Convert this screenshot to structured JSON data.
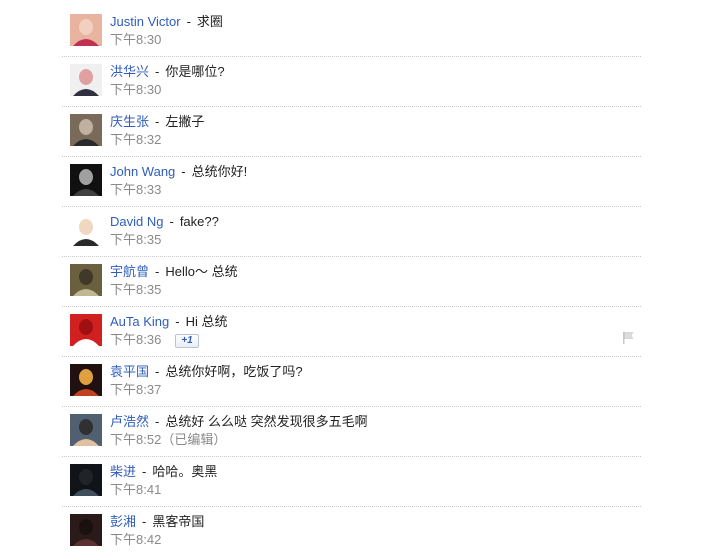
{
  "comments": [
    {
      "author": "Justin Victor",
      "separator": "-",
      "text": "求圈",
      "time": "下午8:30",
      "avatar": "avatar-pink-hair",
      "colors": [
        "#e8b4a0",
        "#c03050",
        "#f2d0c0"
      ]
    },
    {
      "author": "洪华兴",
      "separator": "-",
      "text": "你是哪位?",
      "time": "下午8:30",
      "avatar": "avatar-portrait",
      "colors": [
        "#f0f0f0",
        "#303040",
        "#e0a0a0"
      ]
    },
    {
      "author": "庆生张",
      "separator": "-",
      "text": "左撇子",
      "time": "下午8:32",
      "avatar": "avatar-man-dark",
      "colors": [
        "#7a6a5a",
        "#2a2a2a",
        "#c0b0a0"
      ]
    },
    {
      "author": "John Wang",
      "separator": "-",
      "text": "总统你好!",
      "time": "下午8:33",
      "avatar": "avatar-hooded",
      "colors": [
        "#101010",
        "#404040",
        "#a0a0a0"
      ]
    },
    {
      "author": "David Ng",
      "separator": "-",
      "text": "fake??",
      "time": "下午8:35",
      "avatar": "avatar-cartoon",
      "colors": [
        "#ffffff",
        "#2a2a2a",
        "#f0d8c0"
      ]
    },
    {
      "author": "宇航曾",
      "separator": "-",
      "text": "Hello～ 总统",
      "time": "下午8:35",
      "avatar": "avatar-outdoor",
      "colors": [
        "#6a6040",
        "#c0b890",
        "#403828"
      ]
    },
    {
      "author": "AuTa King",
      "separator": "-",
      "text": "Hi 总统",
      "time": "下午8:36",
      "avatar": "avatar-red-logo",
      "colors": [
        "#d02020",
        "#ffffff",
        "#a01010"
      ],
      "plus_one": "+1",
      "flag_icon": "flag-icon"
    },
    {
      "author": "袁平国",
      "separator": "-",
      "text": "总统你好啊，吃饭了吗?",
      "time": "下午8:37",
      "avatar": "avatar-emblem",
      "colors": [
        "#201010",
        "#c04020",
        "#e0a040"
      ]
    },
    {
      "author": "卢浩然",
      "separator": "-",
      "text": "总统好 么么哒 突然发现很多五毛啊",
      "time": "下午8:52",
      "edited": "（已编辑）",
      "avatar": "avatar-man-photo",
      "colors": [
        "#506070",
        "#e0c0a0",
        "#303030"
      ]
    },
    {
      "author": "柴进",
      "separator": "-",
      "text": "哈哈。奥黑",
      "time": "下午8:41",
      "avatar": "avatar-dark",
      "colors": [
        "#101418",
        "#40505a",
        "#202428"
      ]
    },
    {
      "author": "彭湘",
      "separator": "-",
      "text": "黑客帝国",
      "time": "下午8:42",
      "avatar": "avatar-dim",
      "colors": [
        "#2a1a1a",
        "#5a3030",
        "#1a1010"
      ]
    }
  ]
}
